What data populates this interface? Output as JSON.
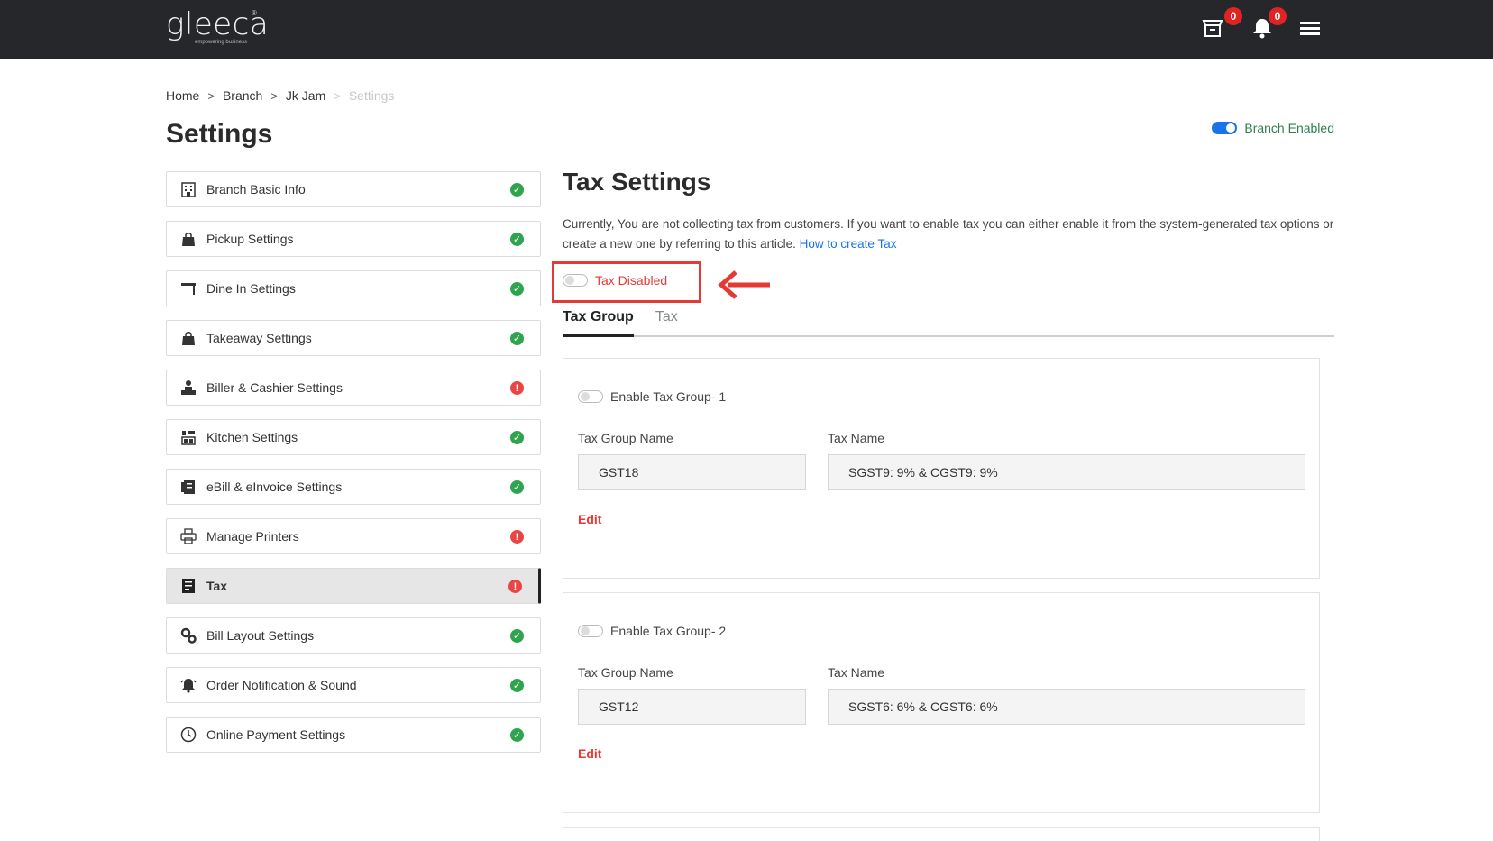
{
  "header": {
    "logo_text": "gleeca",
    "logo_tagline": "empowering business",
    "logo_mark": "®",
    "cart_count": "0",
    "notification_count": "0",
    "icons": [
      "store-icon",
      "bell-icon",
      "menu-icon"
    ]
  },
  "breadcrumb": {
    "items": [
      "Home",
      "Branch",
      "Jk Jam",
      "Settings"
    ],
    "separator": ">"
  },
  "page_title": "Settings",
  "branch_toggle": {
    "label": "Branch Enabled",
    "enabled": true
  },
  "sidebar": {
    "items": [
      {
        "label": "Branch Basic Info",
        "status": "ok",
        "icon": "building-icon"
      },
      {
        "label": "Pickup Settings",
        "status": "ok",
        "icon": "shopping-bag-icon"
      },
      {
        "label": "Dine In Settings",
        "status": "ok",
        "icon": "table-icon"
      },
      {
        "label": "Takeaway Settings",
        "status": "ok",
        "icon": "shopping-bag-icon"
      },
      {
        "label": "Biller & Cashier Settings",
        "status": "warn",
        "icon": "cashier-icon"
      },
      {
        "label": "Kitchen Settings",
        "status": "ok",
        "icon": "kitchen-icon"
      },
      {
        "label": "eBill & eInvoice Settings",
        "status": "ok",
        "icon": "invoice-icon"
      },
      {
        "label": "Manage Printers",
        "status": "warn",
        "icon": "printer-icon"
      },
      {
        "label": "Tax",
        "status": "warn",
        "icon": "tax-receipt-icon",
        "active": true
      },
      {
        "label": "Bill Layout Settings",
        "status": "ok",
        "icon": "gears-icon"
      },
      {
        "label": "Order Notification & Sound",
        "status": "ok",
        "icon": "bell-ring-icon"
      },
      {
        "label": "Online Payment Settings",
        "status": "ok",
        "icon": "clock-icon"
      }
    ],
    "status_ok_glyph": "✓",
    "status_warn_glyph": "!"
  },
  "tax": {
    "title": "Tax Settings",
    "description": "Currently, You are not collecting tax from customers. If you want to enable tax you can either enable it from the system-generated tax options or create a new one by referring to this article.",
    "link_text": "How to create Tax",
    "toggle_label": "Tax Disabled",
    "tabs": [
      "Tax Group",
      "Tax"
    ],
    "groups": [
      {
        "toggle_label": "Enable Tax Group- 1",
        "name_label": "Tax Group Name",
        "name_value": "GST18",
        "tax_label": "Tax Name",
        "tax_value": "SGST9: 9% & CGST9: 9%",
        "edit_label": "Edit"
      },
      {
        "toggle_label": "Enable Tax Group- 2",
        "name_label": "Tax Group Name",
        "name_value": "GST12",
        "tax_label": "Tax Name",
        "tax_value": "SGST6: 6% & CGST6: 6%",
        "edit_label": "Edit"
      }
    ]
  },
  "colors": {
    "topbar": "#25272b",
    "accent_blue": "#1a73e8",
    "ok_green": "#2ea44f",
    "warn_red": "#e84545",
    "annotation_red": "#e53935"
  }
}
